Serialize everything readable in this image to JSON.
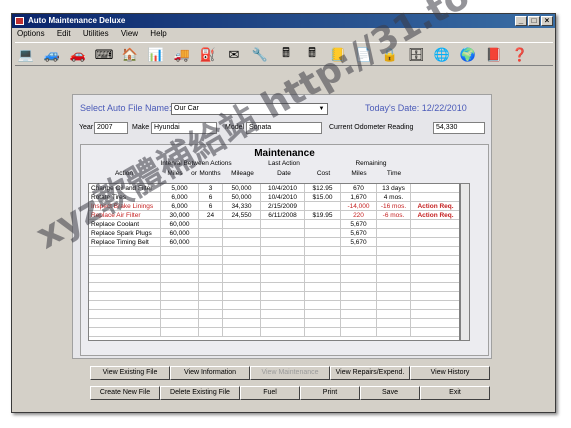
{
  "window": {
    "title": "Auto Maintenance Deluxe",
    "minimize": "_",
    "maximize": "□",
    "close": "×"
  },
  "menu": [
    "Options",
    "Edit",
    "Utilities",
    "View",
    "Help"
  ],
  "toolbar_icons": [
    "computer-icon",
    "car-gray-icon",
    "car-blue-icon",
    "keyboard-icon",
    "house-icon",
    "bar-chart-icon",
    "vehicles-icon",
    "gas-pump-icon",
    "envelope-icon",
    "wrench-icon",
    "calculator-icon",
    "calculator-icon",
    "notepad-icon",
    "document-icon",
    "padlock-icon",
    "safe-icon",
    "globe-icon",
    "globe-search-icon",
    "book-icon",
    "help-icon"
  ],
  "file": {
    "select_label": "Select Auto File Name:",
    "selected": "Our Car",
    "today_label": "Today's Date:",
    "today_value": "12/22/2010",
    "year_label": "Year",
    "year": "2007",
    "make_label": "Make",
    "make": "Hyundai",
    "model_label": "Model",
    "model": "Sonata",
    "odometer_label": "Current Odometer Reading",
    "odometer": "54,330"
  },
  "maintenance": {
    "title": "Maintenance",
    "headers": {
      "interval": "Interval Between Actions",
      "last_action": "Last Action",
      "remaining": "Remaining",
      "action": "Action",
      "miles": "Miles",
      "or": "or",
      "months": "Months",
      "mileage": "Mileage",
      "date": "Date",
      "cost": "Cost",
      "rem_miles": "Miles",
      "time": "Time"
    },
    "rows": [
      {
        "action": "Change Oil and Filter",
        "miles": "5,000",
        "months": "3",
        "mileage": "50,000",
        "date": "10/4/2010",
        "cost": "$12.95",
        "rem_miles": "670",
        "time": "13 days",
        "status": "",
        "overdue": false
      },
      {
        "action": "Rotate Tires",
        "miles": "6,000",
        "months": "6",
        "mileage": "50,000",
        "date": "10/4/2010",
        "cost": "$15.00",
        "rem_miles": "1,670",
        "time": "4 mos.",
        "status": "",
        "overdue": false
      },
      {
        "action": "Inspect Brake Linings",
        "miles": "6,000",
        "months": "6",
        "mileage": "34,330",
        "date": "2/15/2009",
        "cost": "",
        "rem_miles": "-14,000",
        "time": "-16 mos.",
        "status": "Action Req.",
        "overdue": true
      },
      {
        "action": "Replace Air Filter",
        "miles": "30,000",
        "months": "24",
        "mileage": "24,550",
        "date": "6/11/2008",
        "cost": "$19.95",
        "rem_miles": "220",
        "time": "-6 mos.",
        "status": "Action Req.",
        "overdue": true
      },
      {
        "action": "Replace Coolant",
        "miles": "60,000",
        "months": "",
        "mileage": "",
        "date": "",
        "cost": "",
        "rem_miles": "5,670",
        "time": "",
        "status": "",
        "overdue": false
      },
      {
        "action": "Replace Spark Plugs",
        "miles": "60,000",
        "months": "",
        "mileage": "",
        "date": "",
        "cost": "",
        "rem_miles": "5,670",
        "time": "",
        "status": "",
        "overdue": false
      },
      {
        "action": "Replace Timing Belt",
        "miles": "60,000",
        "months": "",
        "mileage": "",
        "date": "",
        "cost": "",
        "rem_miles": "5,670",
        "time": "",
        "status": "",
        "overdue": false
      }
    ]
  },
  "buttons": {
    "row1": [
      "View Existing File",
      "View Information",
      "View Maintenance",
      "View Repairs/Expend.",
      "View History"
    ],
    "row2": [
      "Create New File",
      "Delete Existing File",
      "Fuel",
      "Print",
      "Save",
      "Exit"
    ]
  },
  "watermark": {
    "text": "xyz軟體補給站 http://31.to"
  },
  "colors": {
    "title_bar": "#0a246a",
    "accent_blue": "#4a5ab8",
    "overdue_red": "#c41e1e",
    "window_face": "#d4d0c8"
  }
}
